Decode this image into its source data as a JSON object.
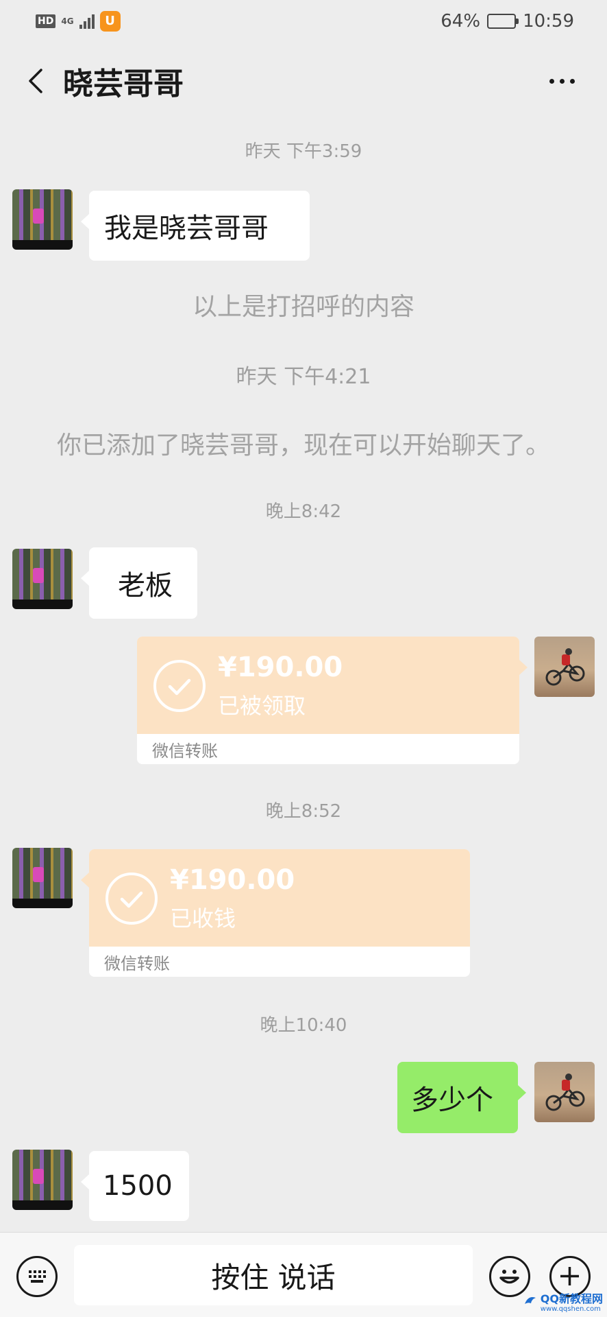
{
  "status_bar": {
    "hd": "HD",
    "network": "4G",
    "battery_percent": "64%",
    "battery_level": 0.64,
    "time": "10:59"
  },
  "header": {
    "title": "晓芸哥哥"
  },
  "messages": {
    "ts1": "昨天 下午3:59",
    "m1": "我是晓芸哥哥",
    "sys1": "以上是打招呼的内容",
    "ts2": "昨天 下午4:21",
    "sys2": "你已添加了晓芸哥哥，现在可以开始聊天了。",
    "ts3": "晚上8:42",
    "m2": "老板",
    "transfer1": {
      "amount": "¥190.00",
      "status": "已被领取",
      "label": "微信转账"
    },
    "ts4": "晚上8:52",
    "transfer2": {
      "amount": "¥190.00",
      "status": "已收钱",
      "label": "微信转账"
    },
    "ts5": "晚上10:40",
    "m3": "多少个",
    "m4": "1500"
  },
  "input_bar": {
    "voice_label": "按住 说话"
  },
  "watermark": {
    "text": "QQ新教程网",
    "sub": "www.qqshen.com"
  },
  "colors": {
    "background": "#ededed",
    "transfer": "#fce2c4",
    "sent_bubble": "#95ec69"
  },
  "icons": [
    "back-chevron-icon",
    "more-icon",
    "keyboard-icon",
    "emoji-icon",
    "plus-icon",
    "check-icon"
  ]
}
